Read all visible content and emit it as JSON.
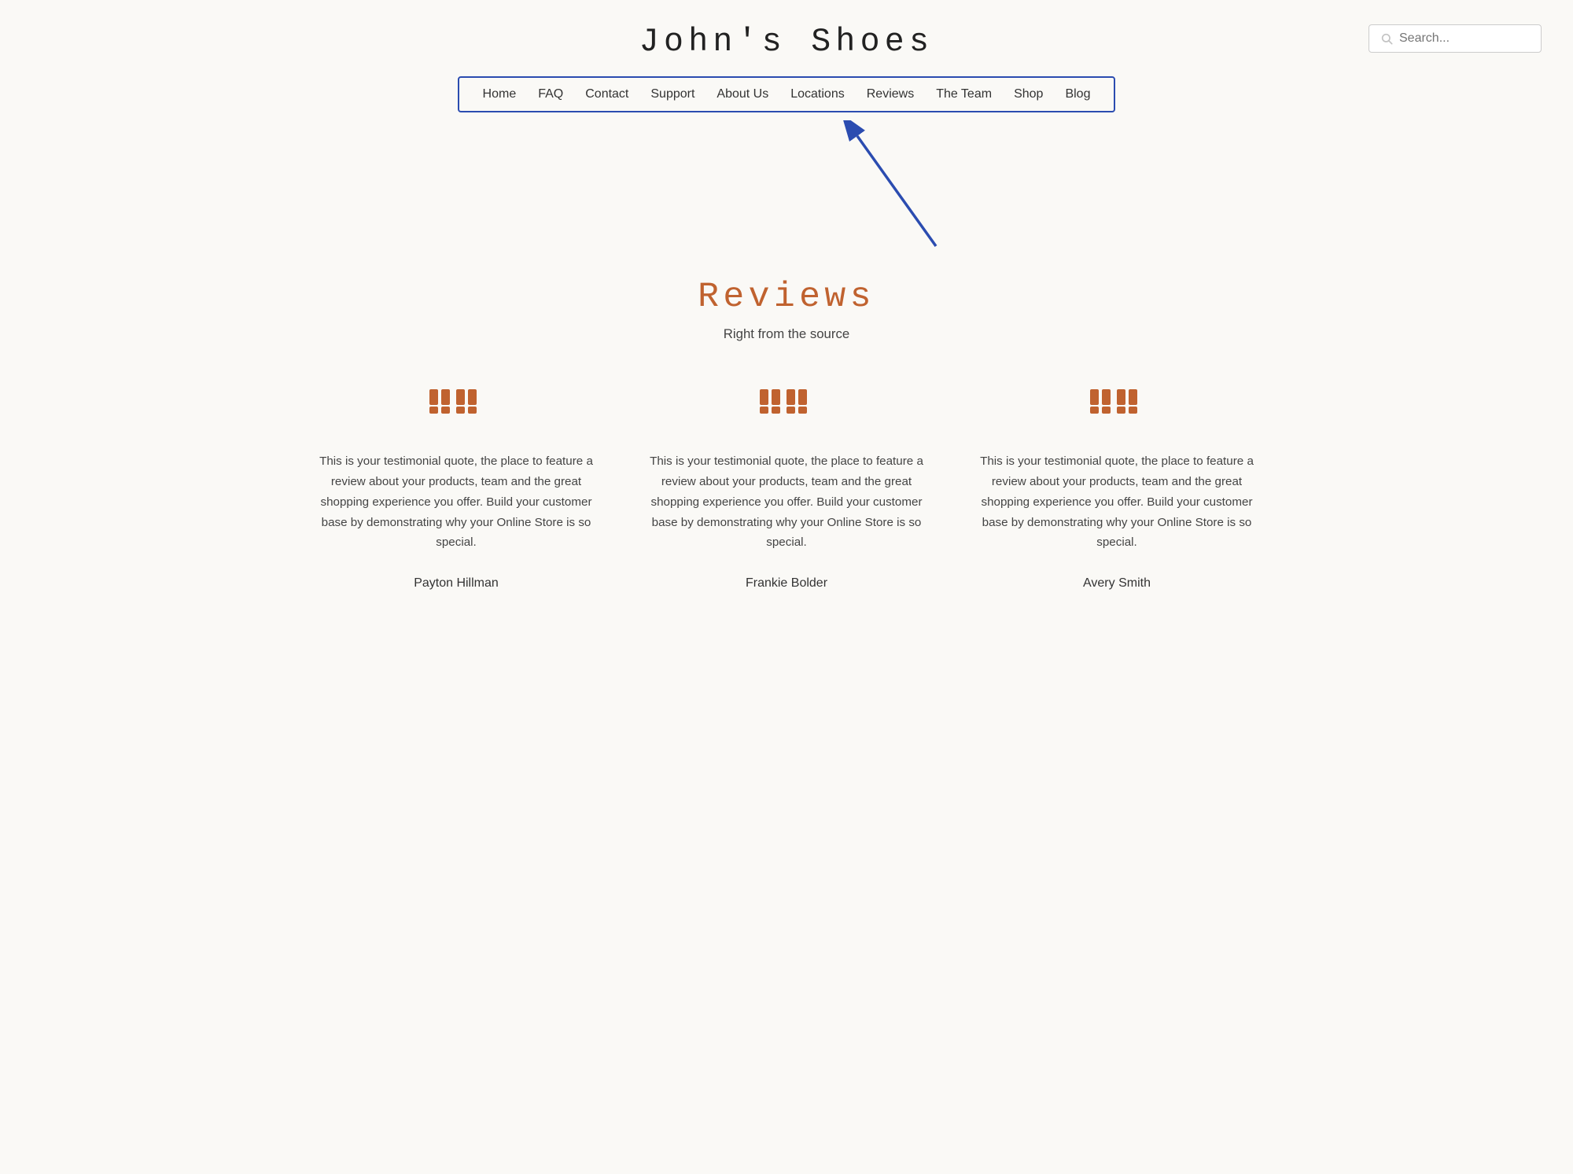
{
  "header": {
    "site_title": "John's Shoes",
    "search_placeholder": "Search..."
  },
  "nav": {
    "items": [
      {
        "label": "Home",
        "id": "home"
      },
      {
        "label": "FAQ",
        "id": "faq"
      },
      {
        "label": "Contact",
        "id": "contact"
      },
      {
        "label": "Support",
        "id": "support"
      },
      {
        "label": "About Us",
        "id": "about"
      },
      {
        "label": "Locations",
        "id": "locations"
      },
      {
        "label": "Reviews",
        "id": "reviews"
      },
      {
        "label": "The Team",
        "id": "team"
      },
      {
        "label": "Shop",
        "id": "shop"
      },
      {
        "label": "Blog",
        "id": "blog"
      }
    ]
  },
  "reviews_section": {
    "title": "Reviews",
    "subtitle": "Right from the source"
  },
  "testimonials": [
    {
      "text": "This is your testimonial quote, the place to feature a review about your products, team and the great shopping experience you offer. Build your customer base by demonstrating why your Online Store is so special.",
      "name": "Payton Hillman"
    },
    {
      "text": "This is your testimonial quote, the place to feature a review about your products, team and the great shopping experience you offer. Build your customer base by demonstrating why your Online Store is so special.",
      "name": "Frankie Bolder"
    },
    {
      "text": "This is your testimonial quote, the place to feature a review about your products, team and the great shopping experience you offer. Build your customer base by demonstrating why your Online Store is so special.",
      "name": "Avery Smith"
    }
  ],
  "colors": {
    "accent": "#c0622f",
    "nav_border": "#2b4cb0",
    "arrow": "#2b4cb0",
    "background": "#faf9f6"
  }
}
